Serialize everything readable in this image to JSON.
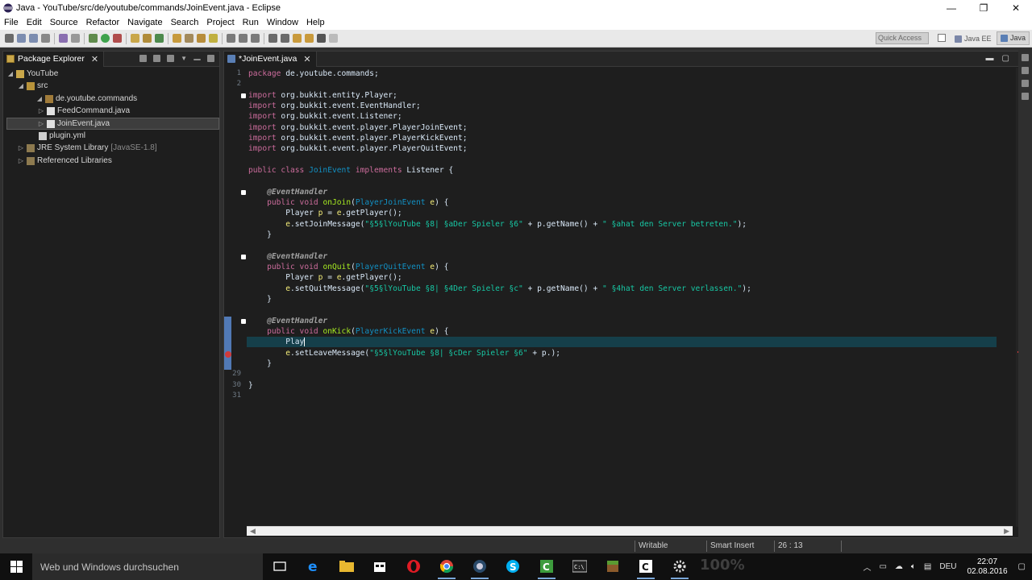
{
  "window": {
    "title": "Java - YouTube/src/de/youtube/commands/JoinEvent.java - Eclipse",
    "minimize": "—",
    "restore": "❐",
    "close": "✕"
  },
  "menu": [
    "File",
    "Edit",
    "Source",
    "Refactor",
    "Navigate",
    "Search",
    "Project",
    "Run",
    "Window",
    "Help"
  ],
  "toolbar": {
    "quick_access_placeholder": "Quick Access",
    "perspective_javaee": "Java EE",
    "perspective_java": "Java"
  },
  "package_explorer": {
    "tab_label": "Package Explorer",
    "tree": [
      {
        "label": "YouTube",
        "extra": "",
        "icon": "project-icon"
      },
      {
        "label": "src",
        "extra": "",
        "icon": "source-folder-icon"
      },
      {
        "label": "de.youtube.commands",
        "extra": "",
        "icon": "package-icon"
      },
      {
        "label": "FeedCommand.java",
        "extra": "",
        "icon": "java-file-icon"
      },
      {
        "label": "JoinEvent.java",
        "extra": "",
        "icon": "java-file-icon"
      },
      {
        "label": "plugin.yml",
        "extra": "",
        "icon": "yml-file-icon"
      },
      {
        "label": "JRE System Library",
        "extra": "[JavaSE-1.8]",
        "icon": "library-icon"
      },
      {
        "label": "Referenced Libraries",
        "extra": "",
        "icon": "library-icon"
      }
    ]
  },
  "editor": {
    "tab_label": "*JoinEvent.java",
    "line_numbers": [
      "1",
      "2",
      "",
      "",
      "",
      "",
      "",
      "",
      "",
      "",
      "",
      "",
      "",
      "",
      "",
      "",
      "",
      "",
      "",
      "",
      "",
      "",
      "",
      "",
      "",
      "",
      "",
      "",
      "29",
      "30",
      "31"
    ]
  },
  "status": {
    "writable": "Writable",
    "insert_mode": "Smart Insert",
    "position": "26 : 13"
  },
  "taskbar": {
    "search_placeholder": "Web und Windows durchsuchen",
    "watermark": "100%",
    "language": "DEU",
    "time": "22:07",
    "date": "02.08.2016"
  },
  "colors": {
    "editor_bg": "#1e1e1e",
    "keyword": "#cc6c9c",
    "type": "#1290c3",
    "method": "#a7ec21",
    "string": "#17c6a3",
    "current_line": "#153f4a"
  }
}
